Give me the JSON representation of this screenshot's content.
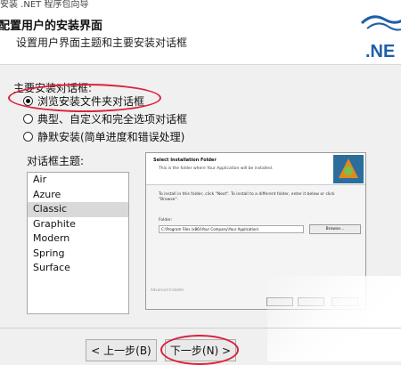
{
  "header": {
    "top_cut_text": "安装 .NET 程序包向导",
    "title": "配置用户的安装界面",
    "subtitle": "设置用户界面主题和主要安装对话框",
    "logo_text": ".NE"
  },
  "dialog_section": {
    "label": "主要安装对话框:",
    "options": [
      {
        "label": "浏览安装文件夹对话框",
        "selected": true
      },
      {
        "label": "典型、自定义和完全选项对话框",
        "selected": false
      },
      {
        "label": "静默安装(简单进度和错误处理)",
        "selected": false
      }
    ]
  },
  "theme_section": {
    "label": "对话框主题:",
    "items": [
      "Air",
      "Azure",
      "Classic",
      "Graphite",
      "Modern",
      "Spring",
      "Surface"
    ],
    "selected": "Classic"
  },
  "preview": {
    "title": "Select Installation Folder",
    "subtitle": "This is the folder where Your Application will be installed.",
    "instructions": "To install in this folder, click \"Next\". To install to a different folder, enter it below or click \"Browse\".",
    "folder_label": "Folder:",
    "folder_value": "C:\\Program Files (x86)\\Your Company\\Your Application\\",
    "browse_label": "Browse...",
    "footer_text": "Advanced Installer"
  },
  "footer": {
    "back_label": "< 上一步(B)",
    "next_label": "下一步(N) >"
  },
  "colors": {
    "highlight": "#d9223e",
    "logo_blue": "#1f5fa8"
  }
}
